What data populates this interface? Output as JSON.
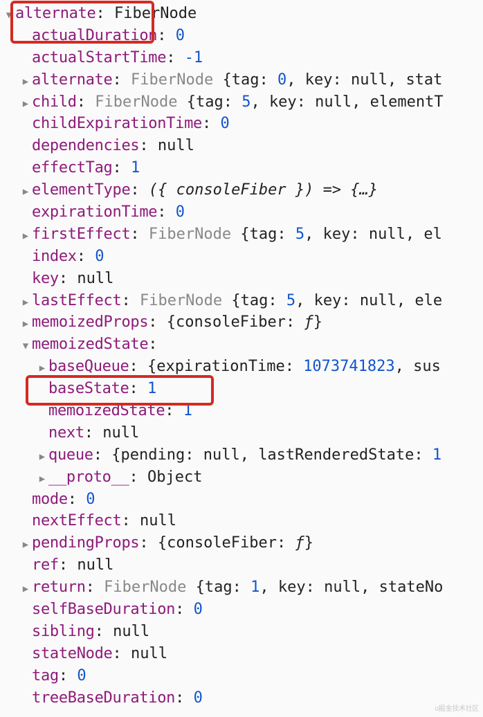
{
  "tree": {
    "root": {
      "key": "alternate",
      "type": "FiberNode"
    },
    "children": [
      {
        "key": "actualDuration",
        "val_num": "0"
      },
      {
        "key": "actualStartTime",
        "val_num": "-1"
      },
      {
        "key": "alternate",
        "obj_type": "FiberNode",
        "preview_parts": [
          {
            "k": "tag",
            "v": "0",
            "num": true
          },
          {
            "k": "key",
            "v": "null"
          },
          {
            "k": "stat",
            "cut": true
          }
        ]
      },
      {
        "key": "child",
        "obj_type": "FiberNode",
        "preview_parts": [
          {
            "k": "tag",
            "v": "5",
            "num": true
          },
          {
            "k": "key",
            "v": "null"
          },
          {
            "k": "elementT",
            "cut": true,
            "keyonly": true
          }
        ]
      },
      {
        "key": "childExpirationTime",
        "val_num": "0"
      },
      {
        "key": "dependencies",
        "val_str": "null"
      },
      {
        "key": "effectTag",
        "val_num": "1"
      },
      {
        "key": "elementType",
        "italic_val": "({ consoleFiber }) => {…}"
      },
      {
        "key": "expirationTime",
        "val_num": "0"
      },
      {
        "key": "firstEffect",
        "obj_type": "FiberNode",
        "preview_parts": [
          {
            "k": "tag",
            "v": "5",
            "num": true
          },
          {
            "k": "key",
            "v": "null"
          },
          {
            "k": "el",
            "cut": true,
            "keyonly": true
          }
        ]
      },
      {
        "key": "index",
        "val_num": "0"
      },
      {
        "key": "key",
        "val_str": "null"
      },
      {
        "key": "lastEffect",
        "obj_type": "FiberNode",
        "preview_parts": [
          {
            "k": "tag",
            "v": "5",
            "num": true
          },
          {
            "k": "key",
            "v": "null"
          },
          {
            "k": "ele",
            "cut": true,
            "keyonly": true
          }
        ]
      },
      {
        "key": "memoizedProps",
        "raw_preview": "{consoleFiber: <i>ƒ</i>}"
      },
      {
        "key": "memoizedState",
        "expanded": true,
        "children": [
          {
            "key": "baseQueue",
            "preview_parts": [
              {
                "k": "expirationTime",
                "v": "1073741823",
                "num": true
              },
              {
                "k": "sus",
                "cut": true,
                "keyonly": true
              }
            ]
          },
          {
            "key": "baseState",
            "val_num": "1",
            "highlight": 2
          },
          {
            "key": "memoizedState",
            "val_num": "1"
          },
          {
            "key": "next",
            "val_str": "null"
          },
          {
            "key": "queue",
            "preview_parts": [
              {
                "k": "pending",
                "v": "null"
              },
              {
                "k": "lastRenderedState",
                "v": "1",
                "num": true,
                "cut_after": true
              }
            ]
          },
          {
            "key": "__proto__",
            "val_str": "Object"
          }
        ]
      },
      {
        "key": "mode",
        "val_num": "0"
      },
      {
        "key": "nextEffect",
        "val_str": "null"
      },
      {
        "key": "pendingProps",
        "raw_preview": "{consoleFiber: <i>ƒ</i>}"
      },
      {
        "key": "ref",
        "val_str": "null"
      },
      {
        "key": "return",
        "obj_type": "FiberNode",
        "preview_parts": [
          {
            "k": "tag",
            "v": "1",
            "num": true
          },
          {
            "k": "key",
            "v": "null"
          },
          {
            "k": "stateNo",
            "cut": true,
            "keyonly": true
          }
        ]
      },
      {
        "key": "selfBaseDuration",
        "val_num": "0"
      },
      {
        "key": "sibling",
        "val_str": "null"
      },
      {
        "key": "stateNode",
        "val_str": "null"
      },
      {
        "key": "tag",
        "val_num": "0"
      },
      {
        "key": "treeBaseDuration",
        "val_num": "0"
      }
    ]
  },
  "watermark": "o掘金技术社区"
}
